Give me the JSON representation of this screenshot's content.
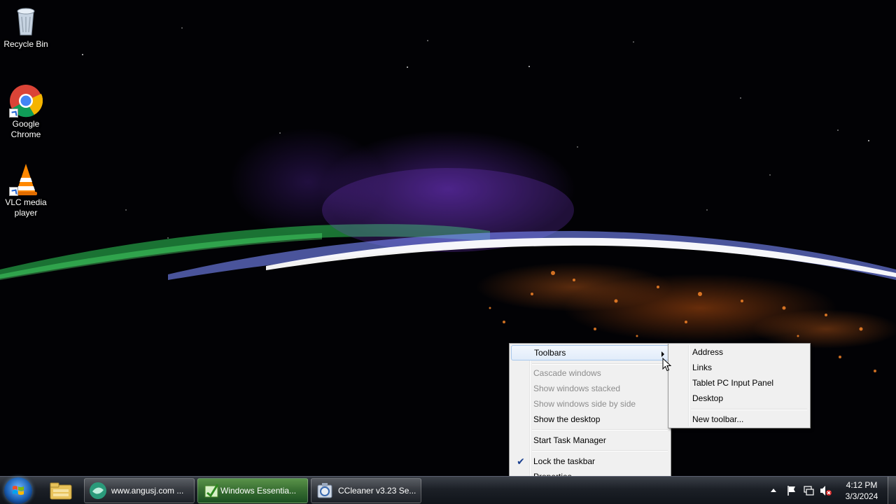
{
  "desktop": {
    "icons": [
      {
        "label": "Recycle Bin",
        "icon": "recycle-bin-icon"
      },
      {
        "label": "Google Chrome",
        "icon": "chrome-icon"
      },
      {
        "label": "VLC media player",
        "icon": "vlc-icon"
      }
    ]
  },
  "context_menu": {
    "items": [
      {
        "label": "Toolbars",
        "state": "highlighted",
        "has_submenu": true
      },
      {
        "label": "Cascade windows",
        "state": "disabled"
      },
      {
        "label": "Show windows stacked",
        "state": "disabled"
      },
      {
        "label": "Show windows side by side",
        "state": "disabled"
      },
      {
        "label": "Show the desktop",
        "state": "enabled"
      },
      {
        "label": "Start Task Manager",
        "state": "enabled"
      },
      {
        "label": "Lock the taskbar",
        "state": "enabled",
        "checked": true
      },
      {
        "label": "Properties",
        "state": "enabled"
      }
    ]
  },
  "toolbars_submenu": {
    "items": [
      {
        "label": "Address"
      },
      {
        "label": "Links"
      },
      {
        "label": "Tablet PC Input Panel"
      },
      {
        "label": "Desktop"
      },
      {
        "label": "New toolbar..."
      }
    ]
  },
  "taskbar": {
    "start_icon": "windows-start-orb",
    "pinned": [
      {
        "icon": "windows-explorer-icon"
      }
    ],
    "buttons": [
      {
        "label": "www.angusj.com ...",
        "icon": "browser-icon",
        "active": false
      },
      {
        "label": "Windows Essentia...",
        "icon": "windows-essentials-icon",
        "active": true
      },
      {
        "label": "CCleaner v3.23 Se...",
        "icon": "ccleaner-setup-icon",
        "active": false
      }
    ],
    "tray_icons": [
      "show-hidden-icons-arrow",
      "action-center-flag-icon",
      "network-icon",
      "volume-muted-icon"
    ],
    "clock": {
      "time": "4:12 PM",
      "date": "3/3/2024"
    }
  },
  "colors": {
    "menu_bg": "#f0f0f0",
    "menu_highlight": "#e1ecfa",
    "disabled_text": "#8d8d8d",
    "active_task_green": "#3fa83a"
  }
}
